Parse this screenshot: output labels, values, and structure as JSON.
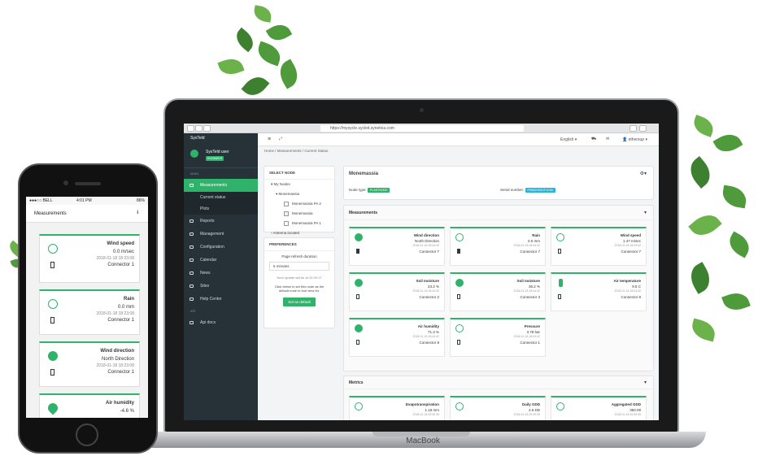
{
  "colors": {
    "accent": "#2fb36b",
    "sidebar": "#263238"
  },
  "laptop": {
    "brand": "MacBook"
  },
  "browser": {
    "url": "https://mysycle.sycleit.synetica.com"
  },
  "app": {
    "brand": "SysTeld",
    "user_name": "SysTeld user",
    "user_badge": "ENGINEER",
    "sidebar_section": "MAIN",
    "sidebar_items": [
      {
        "label": "Measurements",
        "icon": "chart-icon"
      },
      {
        "label": "Reports",
        "icon": "report-icon"
      },
      {
        "label": "Management",
        "icon": "management-icon"
      },
      {
        "label": "Configuration",
        "icon": "gear-icon"
      },
      {
        "label": "Calendar",
        "icon": "calendar-icon"
      },
      {
        "label": "News",
        "icon": "news-icon"
      },
      {
        "label": "Sites",
        "icon": "sites-icon"
      },
      {
        "label": "Help Center",
        "icon": "help-icon"
      }
    ],
    "sidebar_sub": [
      "Current status",
      "Plots"
    ],
    "sidebar_section2": "API",
    "sidebar_api": "Api docs",
    "topbar": {
      "language": "English",
      "user": "ethersup"
    },
    "breadcrumb": [
      "Home",
      "Measurements",
      "Current Status"
    ],
    "tree_panel": {
      "title": "SELECT NODE",
      "my_nodes": "My Nodes",
      "group": "Monemassia",
      "nodes": [
        "Monemassia PA 2",
        "Monemassia",
        "Monemassia PA 1"
      ],
      "antenna": "Antenna located"
    },
    "prefs_panel": {
      "title": "PREFERENCES",
      "refresh_label": "Page refresh duration",
      "refresh_value": "5 minutes",
      "next_update": "Next update will be at 10:09:17",
      "hint": "Click below to set this node as the default node to foot view for.",
      "button": "Set as default"
    },
    "node": {
      "name": "Monemassia",
      "node_type_label": "Node type:",
      "node_type": "PLANTNODE",
      "serial_label": "Serial number:",
      "serial": "P006CHO0CF1C0A"
    },
    "sections": {
      "measurements": "Measurements",
      "metrics": "Metrics"
    },
    "cards": [
      {
        "title": "Wind direction",
        "value": "North Direction",
        "time": "2018-01-18 18:44:42",
        "connector": "Connector 7"
      },
      {
        "title": "Rain",
        "value": "0.0 mm",
        "time": "2018-01-18 18:44:42",
        "connector": "Connector 7"
      },
      {
        "title": "Wind speed",
        "value": "1.47 m/sec",
        "time": "2018-01-18 18:44:42",
        "connector": "Connector 7"
      },
      {
        "title": "Soil moisture",
        "value": "23.2 %",
        "time": "2018-01-18 18:44:42",
        "connector": "Connector 2"
      },
      {
        "title": "Soil moisture",
        "value": "36.2 %",
        "time": "2018-01-18 18:44:42",
        "connector": "Connector 3"
      },
      {
        "title": "Air temperature",
        "value": "9.5 C",
        "time": "2018-01-18 18:44:42",
        "connector": "Connector 8"
      },
      {
        "title": "Air humidity",
        "value": "71.3 %",
        "time": "2018-01-18 18:44:42",
        "connector": "Connector 8"
      },
      {
        "title": "Pressure",
        "value": "3.78 bar",
        "time": "2018-01-18 18:44:42",
        "connector": "Connector 1"
      }
    ],
    "metrics": [
      {
        "title": "Evapotranspiration",
        "value": "1.16 mm",
        "time": "2018-01-18 20:39:39"
      },
      {
        "title": "Daily GDD",
        "value": "4.6 DD",
        "time": "2018-01-18 20:39:39"
      },
      {
        "title": "Aggregated GDD",
        "value": "350.09",
        "time": "2018-01-18 20:39:39"
      }
    ]
  },
  "phone": {
    "carrier": "BELL",
    "time": "4:01 PM",
    "battery": "86%",
    "header": "Measurements",
    "cards": [
      {
        "title": "Wind speed",
        "value": "0.0 m/sec",
        "time": "2018-01-18 18:23:08",
        "connector": "Connector 1"
      },
      {
        "title": "Rain",
        "value": "0.0 mm",
        "time": "2018-01-18 18:23:08",
        "connector": "Connector 1"
      },
      {
        "title": "Wind direction",
        "value": "North Direction",
        "time": "2018-01-18 18:23:08",
        "connector": "Connector 1"
      },
      {
        "title": "Air humidity",
        "value": "-4.6 %",
        "time": "",
        "connector": ""
      }
    ]
  }
}
